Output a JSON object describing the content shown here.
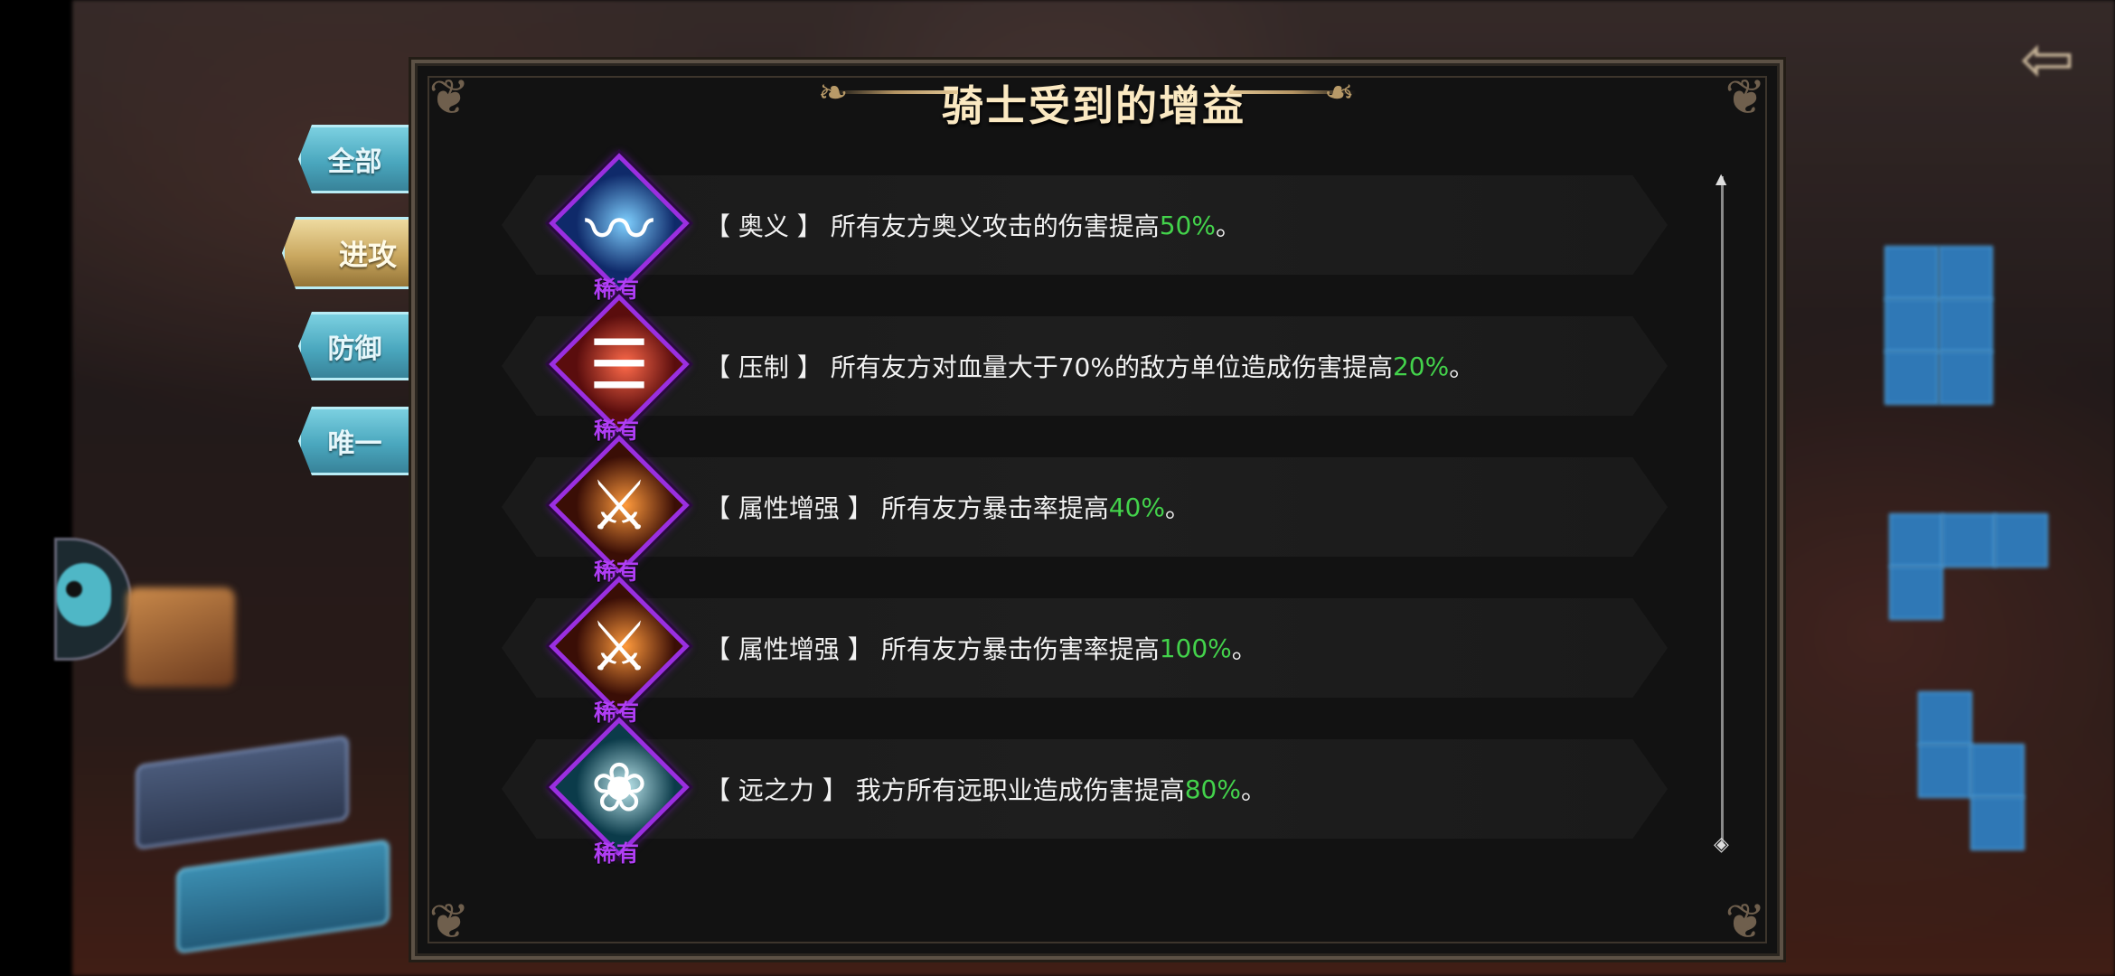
{
  "panel": {
    "title": "骑士受到的增益"
  },
  "tabs": [
    {
      "label": "全部"
    },
    {
      "label": "进攻"
    },
    {
      "label": "防御"
    },
    {
      "label": "唯一"
    }
  ],
  "buffs": [
    {
      "tag": "【 奥义 】",
      "desc": " 所有友方奥义攻击的伤害提高",
      "value": "50%",
      "end": "。",
      "rarity": "稀有",
      "icon": "wind-slash-icon",
      "icon_colors": [
        "#0f2a6a",
        "#7fd0ff"
      ]
    },
    {
      "tag": "【 压制 】",
      "desc": " 所有友方对血量大于70%的敌方单位造成伤害提高",
      "value": "20%",
      "end": "。",
      "rarity": "稀有",
      "icon": "claw-slash-icon",
      "icon_colors": [
        "#5a0d0d",
        "#ff6a4a"
      ]
    },
    {
      "tag": "【 属性增强 】",
      "desc": " 所有友方暴击率提高",
      "value": "40%",
      "end": "。",
      "rarity": "稀有",
      "icon": "fire-sword-icon",
      "icon_colors": [
        "#3a0e06",
        "#ff9a3c"
      ]
    },
    {
      "tag": "【 属性增强 】",
      "desc": " 所有友方暴击伤害率提高",
      "value": "100%",
      "end": "。",
      "rarity": "稀有",
      "icon": "fire-sword-icon",
      "icon_colors": [
        "#3a0e06",
        "#ff9a3c"
      ]
    },
    {
      "tag": "【 远之力 】",
      "desc": " 我方所有远职业造成伤害提高",
      "value": "80%",
      "end": "。",
      "rarity": "稀有",
      "icon": "leaf-shell-icon",
      "icon_colors": [
        "#0b3b4a",
        "#bfe9ef"
      ]
    }
  ],
  "colors": {
    "highlight": "#43d24b",
    "rarity": "#b13ef5",
    "title": "#fbe9c2"
  }
}
